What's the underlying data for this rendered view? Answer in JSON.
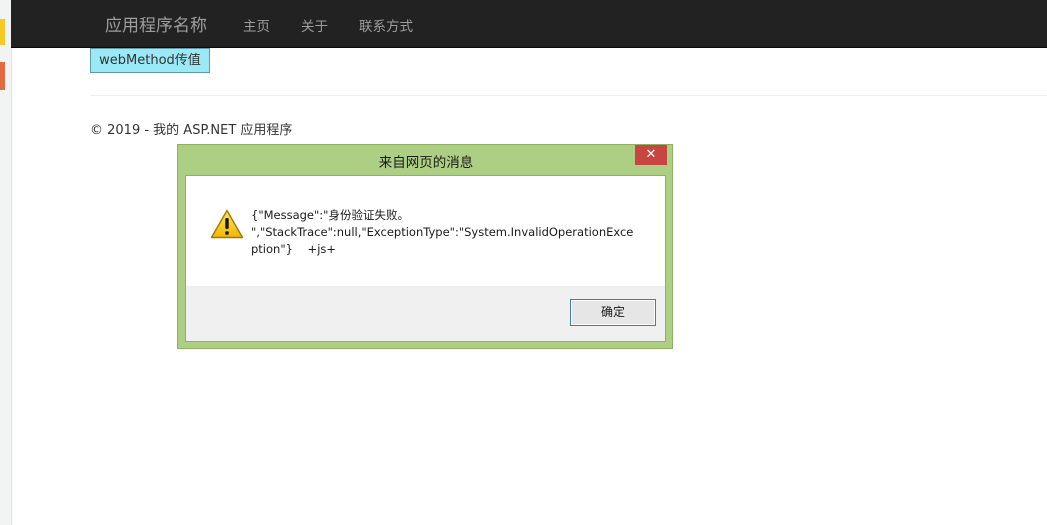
{
  "navbar": {
    "brand": "应用程序名称",
    "links": [
      "主页",
      "关于",
      "联系方式"
    ]
  },
  "main": {
    "button_label": "webMethod传值"
  },
  "footer": {
    "text": "© 2019 - 我的 ASP.NET 应用程序"
  },
  "dialog": {
    "title": "来自网页的消息",
    "close_glyph": "✕",
    "message_lines": [
      "{\"Message\":\"身份验证失败。",
      "\",\"StackTrace\":null,\"ExceptionType\":\"System.InvalidOperationExce",
      "ption\"}    +js+"
    ],
    "ok_label": "确定",
    "icon": "warning-icon"
  },
  "colors": {
    "navbar_bg": "#222222",
    "button_bg": "#9be8f6",
    "dialog_frame": "#adcf84",
    "close_button": "#c7463f"
  }
}
